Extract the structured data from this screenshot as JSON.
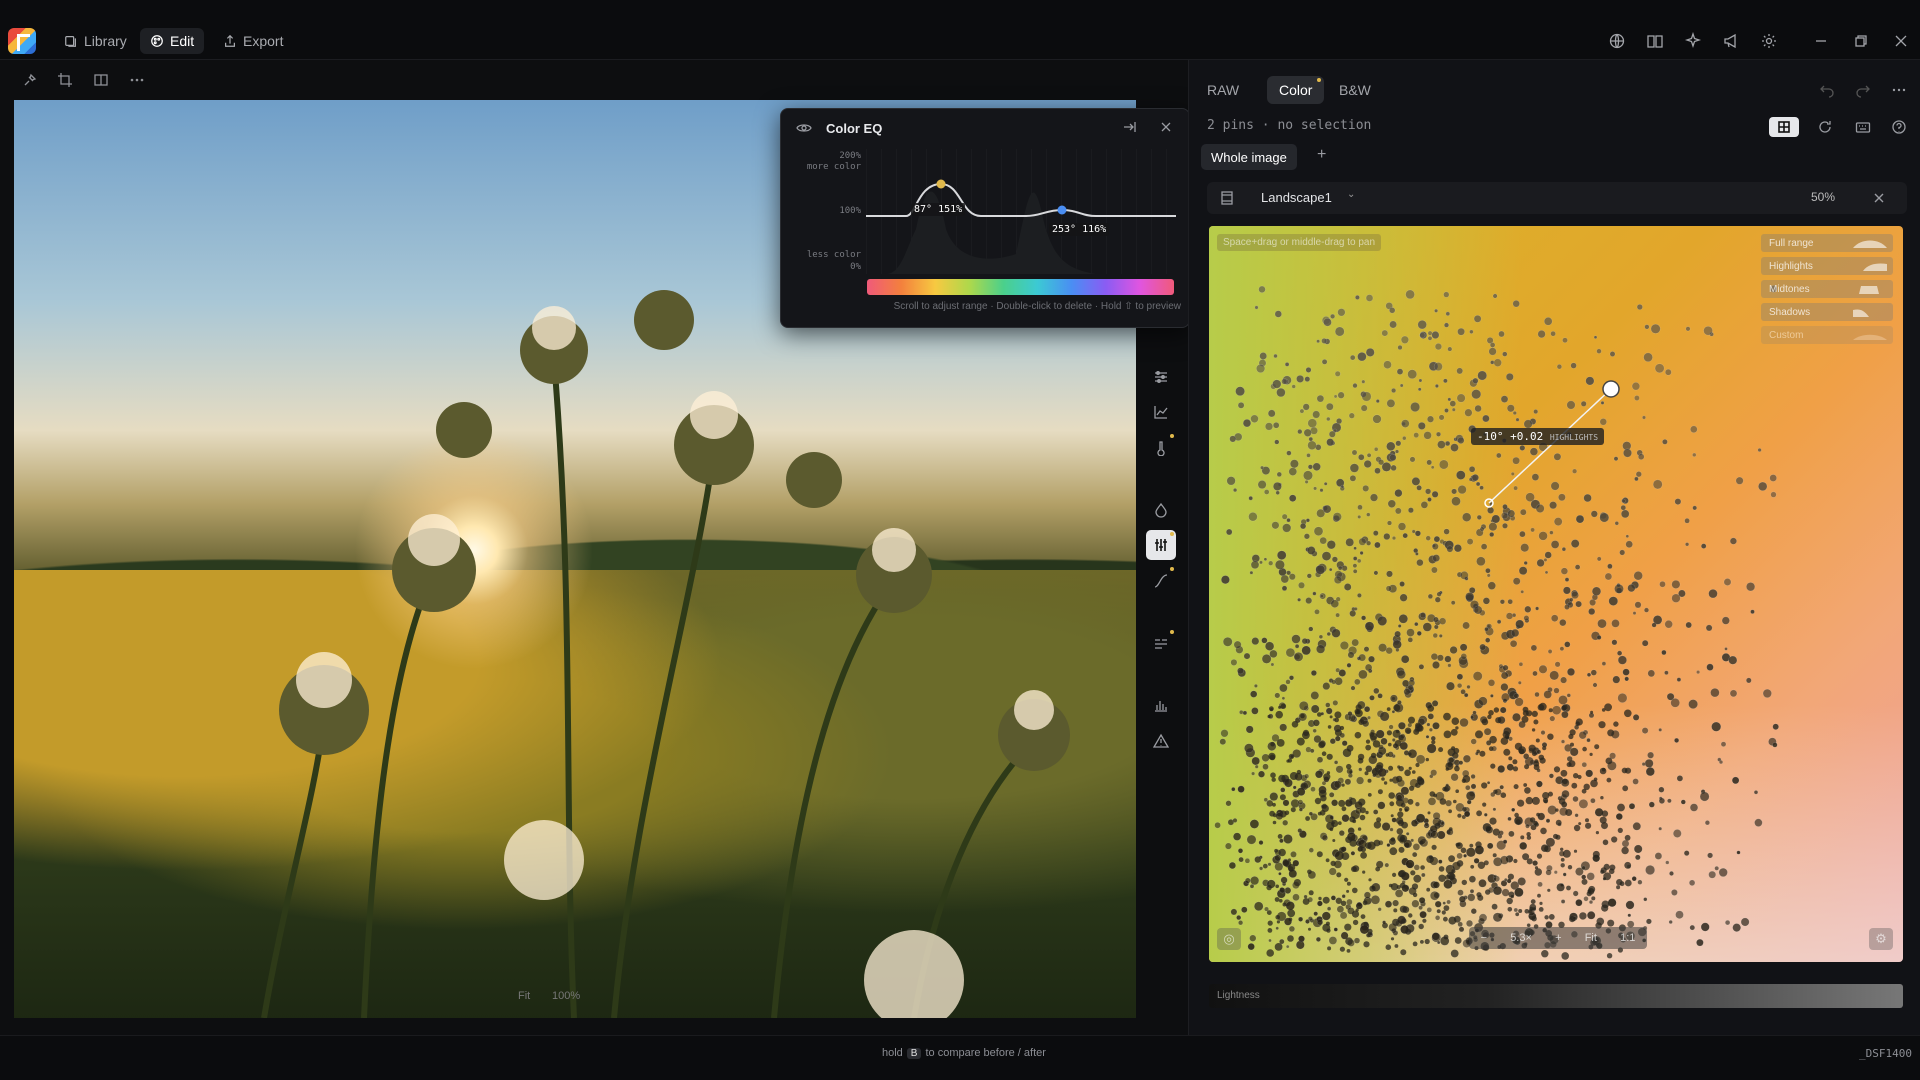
{
  "topbar": {
    "tabs": [
      {
        "label": "Library"
      },
      {
        "label": "Edit"
      },
      {
        "label": "Export"
      }
    ]
  },
  "photo": {
    "zoom_fit": "Fit",
    "zoom_100": "100%"
  },
  "color_eq": {
    "title": "Color EQ",
    "y_top": "200%",
    "y_top_sub": "more color",
    "y_mid": "100%",
    "y_bottom_sub": "less color",
    "y_bottom": "0%",
    "pin1": "87° 151%",
    "pin2": "253° 116%",
    "hint": "Scroll to adjust range · Double-click to delete · Hold ⇧ to preview"
  },
  "right_panel": {
    "tabs": [
      {
        "label": "RAW"
      },
      {
        "label": "Color"
      },
      {
        "label": "B&W"
      }
    ],
    "pin_status": "2 pins · no selection",
    "whole_image": "Whole image",
    "add": "+",
    "scope_name": "Landscape1",
    "scope_zoom": "50%",
    "pan_hint": "Space+drag or middle-drag to pan",
    "ranges": [
      {
        "label": "Full range"
      },
      {
        "label": "Highlights"
      },
      {
        "label": "Midtones"
      },
      {
        "label": "Shadows"
      },
      {
        "label": "Custom"
      }
    ],
    "pin_readout": "-10° +0.02",
    "pin_readout_tag": "HIGHLIGHTS",
    "zoombar": {
      "minus": "−",
      "value": "5.3×",
      "plus": "+",
      "fit": "Fit",
      "one": "1:1"
    },
    "lightness": "Lightness"
  },
  "status": {
    "hold": "hold",
    "key": "B",
    "compare": "to compare before / after",
    "filename": "_DSF1400"
  },
  "colors": {
    "accent_pin_warm": "#e0b94c",
    "accent_pin_cool": "#4a8ef3"
  }
}
